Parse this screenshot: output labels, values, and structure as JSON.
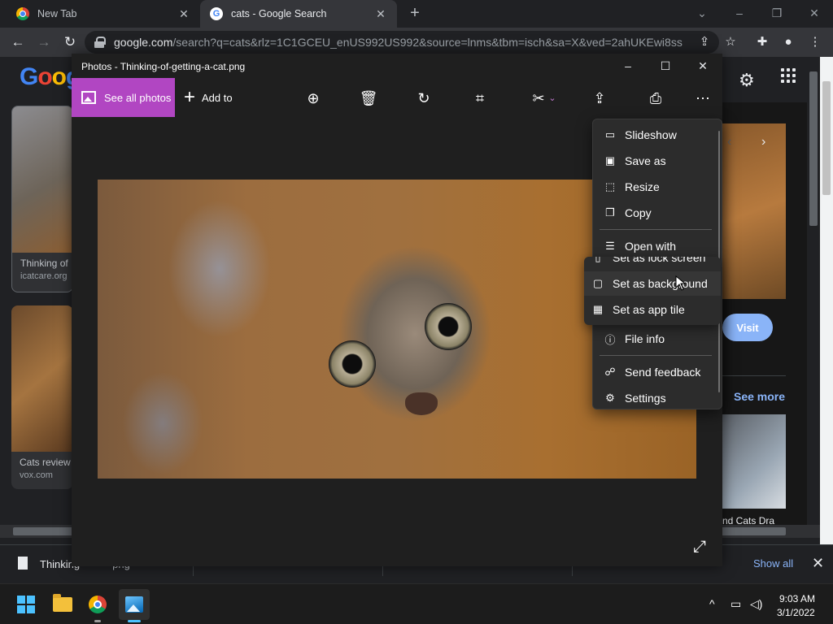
{
  "browser": {
    "tabs": [
      {
        "title": "New Tab",
        "icon": "chrome-icon",
        "active": false
      },
      {
        "title": "cats - Google Search",
        "icon": "google-icon",
        "active": true
      }
    ],
    "url_host": "google.com",
    "url_rest": "/search?q=cats&rlz=1C1GCEU_enUS992US992&source=lnms&tbm=isch&sa=X&ved=2ahUKEwi8ss..."
  },
  "google": {
    "logo": "Goog",
    "results": [
      {
        "caption": "Thinking of",
        "source": "icatcare.org"
      },
      {
        "caption": "Cats review",
        "source": "vox.com"
      }
    ],
    "visit_label": "Visit",
    "see_more_label": "See more",
    "related_caption": "nd Cats Dra"
  },
  "photos": {
    "window_title": "Photos - Thinking-of-getting-a-cat.png",
    "see_all_label": "See all photos",
    "add_to_label": "Add to",
    "accent": "#b146c2"
  },
  "menu": {
    "items": [
      {
        "label": "Slideshow",
        "icon": "slideshow-icon"
      },
      {
        "label": "Save as",
        "icon": "save-icon"
      },
      {
        "label": "Resize",
        "icon": "resize-icon"
      },
      {
        "label": "Copy",
        "icon": "copy-icon"
      },
      {
        "label": "Open with",
        "icon": "open-with-icon"
      }
    ],
    "submenu": [
      {
        "label": "Set as lock screen",
        "icon": "lock-screen-icon"
      },
      {
        "label": "Set as background",
        "icon": "background-icon"
      },
      {
        "label": "Set as app tile",
        "icon": "app-tile-icon"
      }
    ],
    "lower_items": [
      {
        "label": "File info",
        "icon": "info-icon"
      },
      {
        "label": "Send feedback",
        "icon": "feedback-icon"
      },
      {
        "label": "Settings",
        "icon": "settings-icon"
      }
    ]
  },
  "downloads": {
    "file": "Thinking",
    "file_suffix": "png",
    "show_all_label": "Show all"
  },
  "taskbar": {
    "time": "9:03 AM",
    "date": "3/1/2022"
  }
}
